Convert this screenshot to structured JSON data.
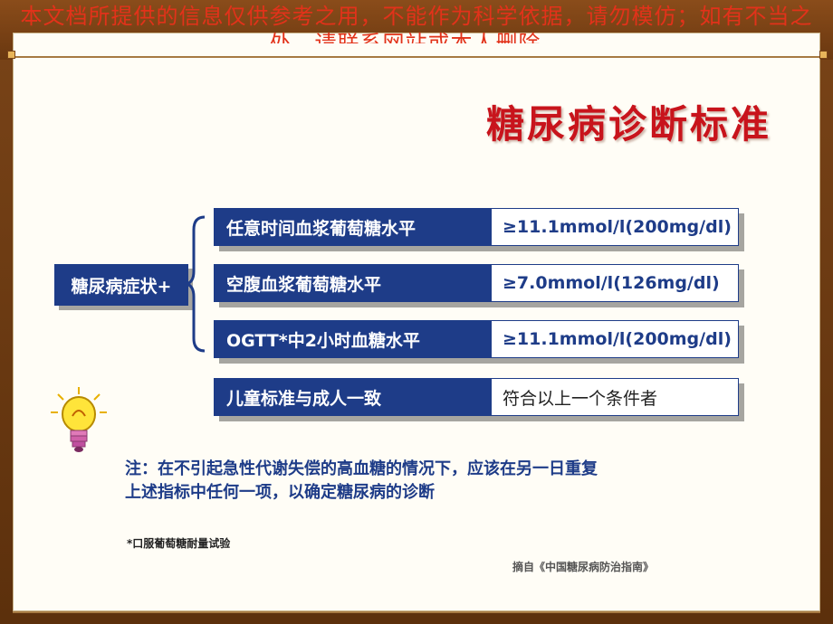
{
  "disclaimer": {
    "line1": "本文档所提供的信息仅供参考之用，不能作为科学依据，请勿模仿；如有不当之",
    "line2": "处，请联系网站或本人删除。"
  },
  "title": "糖尿病诊断标准",
  "symptom_label": "糖尿病症状+",
  "criteria": [
    {
      "label": "任意时间血浆葡萄糖水平",
      "value": "≥11.1mmol/l(200mg/dl)"
    },
    {
      "label": "空腹血浆葡萄糖水平",
      "value": "≥7.0mmol/l(126mg/dl)"
    },
    {
      "label": "OGTT*中2小时血糖水平",
      "value": "≥11.1mmol/l(200mg/dl)"
    },
    {
      "label": "儿童标准与成人一致",
      "value": "符合以上一个条件者"
    }
  ],
  "note": {
    "line1": "注：在不引起急性代谢失偿的高血糖的情况下，应该在另一日重复",
    "line2": "上述指标中任何一项，以确定糖尿病的诊断"
  },
  "footnote": "*口服葡萄糖耐量试验",
  "source": "摘自《中国糖尿病防治指南》",
  "icons": [
    "lightbulb-icon"
  ],
  "colors": {
    "box_blue": "#1e3c88",
    "title_red": "#c8141c",
    "frame_brown": "#6a3810"
  }
}
